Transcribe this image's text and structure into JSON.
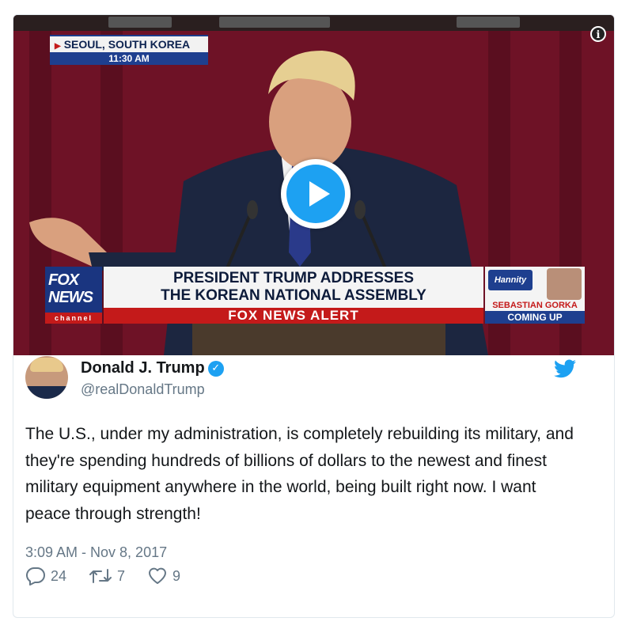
{
  "video": {
    "dateline_location": "SEOUL, SOUTH KOREA",
    "dateline_time": "11:30 AM",
    "headline_line1": "PRESIDENT TRUMP ADDRESSES",
    "headline_line2": "THE KOREAN NATIONAL ASSEMBLY",
    "alert": "FOX NEWS ALERT",
    "logo_line1": "FOX",
    "logo_line2": "NEWS",
    "logo_channel": "channel",
    "promo_show": "Hannity",
    "promo_guest": "SEBASTIAN GORKA",
    "promo_status": "COMING UP",
    "play_icon": "play-icon",
    "info_icon": "info-icon"
  },
  "tweet": {
    "display_name": "Donald J. Trump",
    "handle": "@realDonaldTrump",
    "text": "The U.S., under my administration, is completely rebuilding its military, and they're spending hundreds of billions of dollars to the newest and finest military equipment anywhere in the world, being built right now. I want peace through strength!",
    "timestamp": "3:09 AM - Nov 8, 2017",
    "replies": "24",
    "retweets": "7",
    "likes": "9"
  },
  "colors": {
    "twitter_blue": "#1da1f2",
    "text_primary": "#14171a",
    "text_secondary": "#657786",
    "fox_red": "#c41a1a",
    "fox_blue": "#1e3f8f"
  }
}
